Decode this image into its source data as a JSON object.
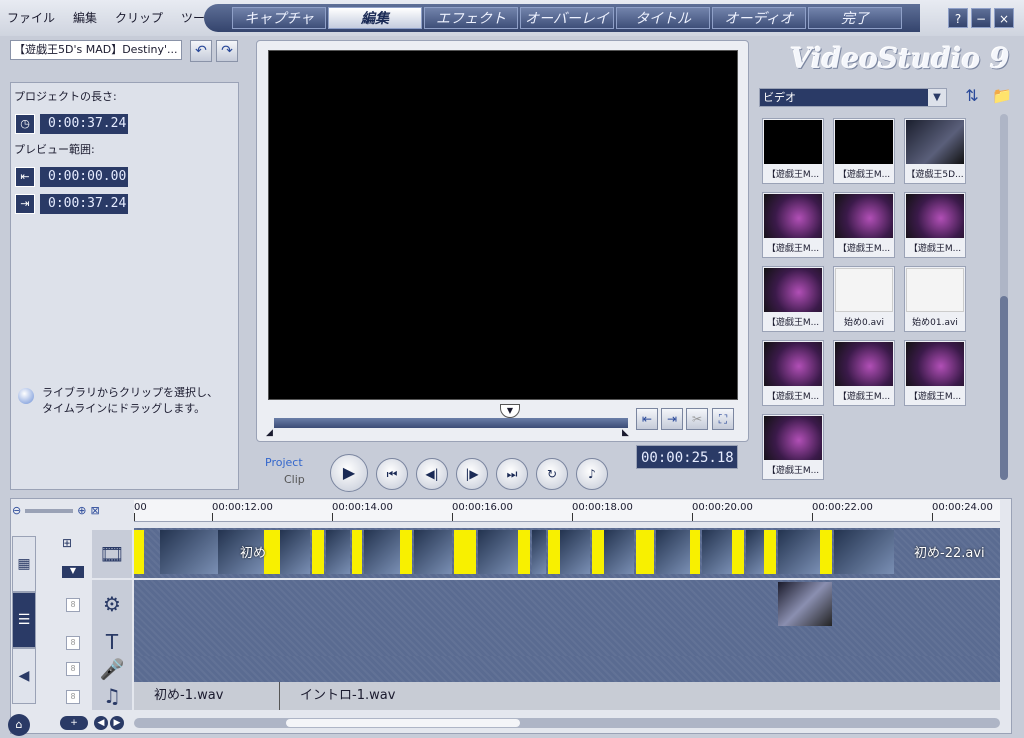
{
  "menu": [
    "ファイル",
    "編集",
    "クリップ",
    "ツール"
  ],
  "steps": [
    {
      "label": "キャプチャ",
      "active": false
    },
    {
      "label": "編集",
      "active": true
    },
    {
      "label": "エフェクト",
      "active": false
    },
    {
      "label": "オーバーレイ",
      "active": false
    },
    {
      "label": "タイトル",
      "active": false
    },
    {
      "label": "オーディオ",
      "active": false
    },
    {
      "label": "完了",
      "active": false
    }
  ],
  "window_controls": [
    "?",
    "−",
    "×"
  ],
  "project": {
    "name": "【遊戯王5D's MAD】Destiny'...",
    "length_label": "プロジェクトの長さ:",
    "length_value": "0:00:37.24",
    "range_label": "プレビュー範囲:",
    "range_start": "0:00:00.00",
    "range_end": "0:00:37.24",
    "hint_line1": "ライブラリからクリップを選択し、",
    "hint_line2": "タイムラインにドラッグします。"
  },
  "preview": {
    "timecode": "00:00:25.18",
    "project_label": "Project",
    "clip_label": "Clip"
  },
  "library": {
    "logo": "VideoStudio 9",
    "category": "ビデオ",
    "thumbs": [
      {
        "caption": "【遊戯王M...",
        "style": "black"
      },
      {
        "caption": "【遊戯王M...",
        "style": "black"
      },
      {
        "caption": "【遊戯王5D...",
        "style": "dark"
      },
      {
        "caption": "【遊戯王M...",
        "style": "purple"
      },
      {
        "caption": "【遊戯王M...",
        "style": "purple"
      },
      {
        "caption": "【遊戯王M...",
        "style": "purple"
      },
      {
        "caption": "【遊戯王M...",
        "style": "purple"
      },
      {
        "caption": "始め0.avi",
        "style": "white"
      },
      {
        "caption": "始め01.avi",
        "style": "white"
      },
      {
        "caption": "【遊戯王M...",
        "style": "purple"
      },
      {
        "caption": "【遊戯王M...",
        "style": "purple"
      },
      {
        "caption": "【遊戯王M...",
        "style": "purple"
      },
      {
        "caption": "【遊戯王M...",
        "style": "purple"
      }
    ]
  },
  "timeline": {
    "ruler": [
      "00",
      "00:00:12.00",
      "00:00:14.00",
      "00:00:16.00",
      "00:00:18.00",
      "00:00:20.00",
      "00:00:22.00",
      "00:00:24.00"
    ],
    "video_clip_label_left": "初め",
    "video_clip_label_right": "初め-22.avi",
    "audio_clips": [
      "初め-1.wav",
      "イントロ-1.wav"
    ]
  }
}
